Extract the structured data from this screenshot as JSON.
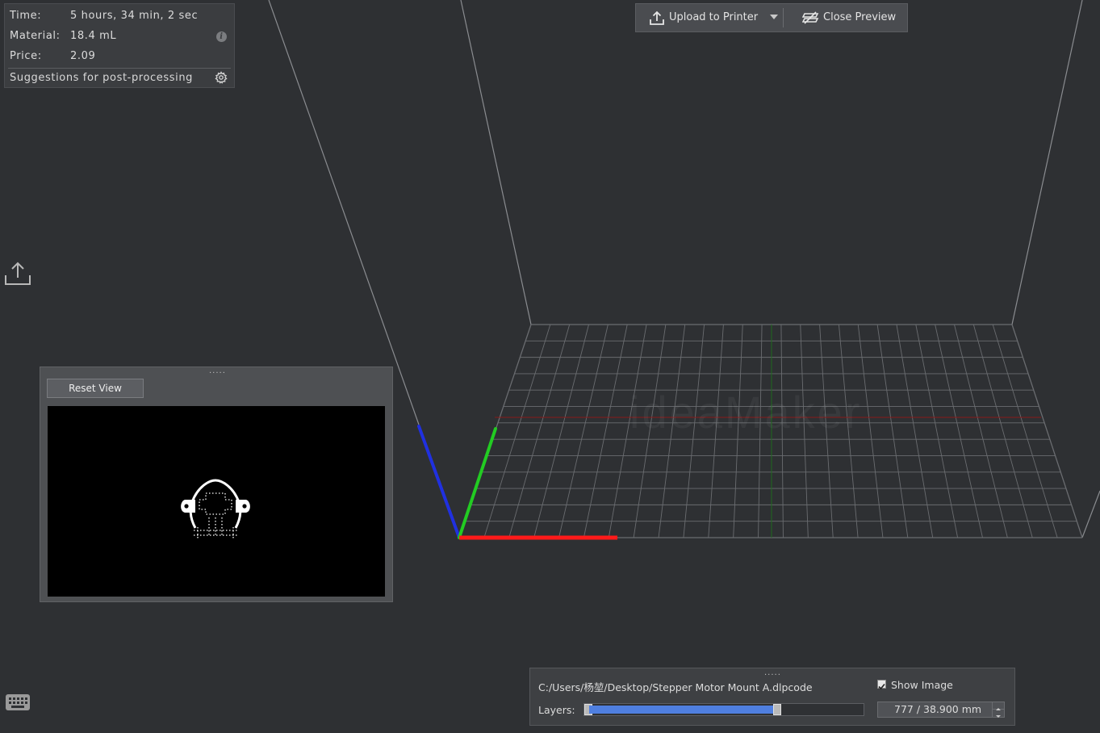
{
  "info": {
    "time_label": "Time:",
    "time_value": "5 hours, 34 min, 2 sec",
    "material_label": "Material:",
    "material_value": "18.4 mL",
    "price_label": "Price:",
    "price_value": "2.09",
    "post_processing": "Suggestions for post-processing"
  },
  "toolbar": {
    "upload_label": "Upload to Printer",
    "close_label": "Close Preview"
  },
  "scene": {
    "watermark": "ideaMaker",
    "axis_colors": {
      "x": "#ff1a1a",
      "y": "#22cc22",
      "z": "#2030e0"
    },
    "grid_color": "#6a6c70"
  },
  "preview": {
    "reset_label": "Reset View",
    "grip": "....."
  },
  "layer_panel": {
    "grip": ".....",
    "file_path": "C:/Users/杨堃/Desktop/Stepper Motor Mount A.dlpcode",
    "show_image_label": "Show Image",
    "show_image_checked": true,
    "layers_label": "Layers:",
    "current_layer": "777",
    "max_height": "38.900 mm",
    "layer_value_text": "777 / 38.900 mm",
    "slider_fraction": 0.69
  }
}
